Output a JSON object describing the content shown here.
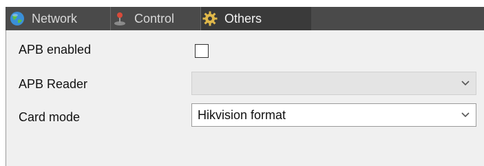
{
  "tabs": [
    {
      "label": "Network",
      "icon": "globe-icon"
    },
    {
      "label": "Control",
      "icon": "joystick-icon"
    },
    {
      "label": "Others",
      "icon": "gear-icon",
      "active": true
    }
  ],
  "form": {
    "apb_enabled_label": "APB enabled",
    "apb_enabled_checked": false,
    "apb_reader_label": "APB Reader",
    "apb_reader_value": "",
    "card_mode_label": "Card mode",
    "card_mode_value": "Hikvision format"
  },
  "colors": {
    "tabbar_bg": "#4a4a4a",
    "active_tab_bg": "#3a3a3a",
    "panel_bg": "#f0f0f0",
    "gear_icon": "#e0b84a",
    "globe_icon": "#3a8fd8"
  }
}
